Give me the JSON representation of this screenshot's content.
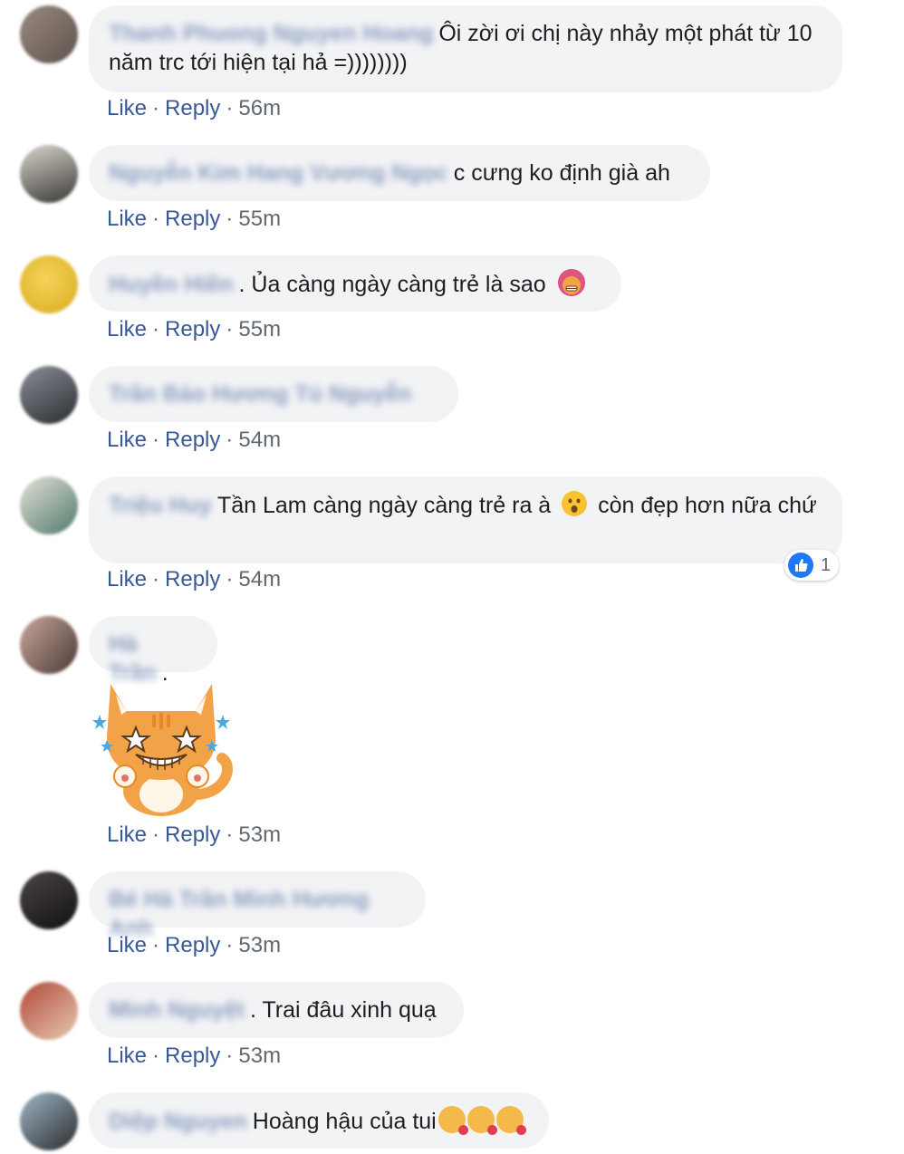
{
  "actions": {
    "like": "Like",
    "reply": "Reply",
    "sep": "·"
  },
  "comments": [
    {
      "name": "Thanh Phuong Nguyen Hoang",
      "text": "Ôi zời ơi chị này nhảy một phát từ 10 năm trc tới hiện tại hả =))))))))",
      "time": "56m"
    },
    {
      "name": "Nguyễn Kim Hang Vương Ngọc",
      "text": "c cưng ko định già ah",
      "time": "55m"
    },
    {
      "name": "Huyền Hiền",
      "text": ". Ủa càng ngày càng trẻ là sao",
      "emoji": "hot-face-emoji",
      "time": "55m"
    },
    {
      "name": "Trần Bảo Hương Tú Nguyễn",
      "text": "",
      "time": "54m"
    },
    {
      "name": "Triệu Huy",
      "text_before": "Tần Lam càng ngày càng trẻ ra à",
      "emoji": "astonished-face-emoji",
      "text_after": "còn đẹp hơn nữa chứ",
      "time": "54m",
      "reaction_count": "1"
    },
    {
      "name": "Hà Trần",
      "text": ".",
      "sticker": "cat-sticker",
      "time": "53m"
    },
    {
      "name": "Bé Hà Trần Minh Hương Anh",
      "text": "",
      "time": "53m"
    },
    {
      "name": "Minh Nguyệt",
      "text": ". Trai đâu xinh quạ",
      "time": "53m"
    },
    {
      "name": "Diệp Nguyen",
      "text": "Hoàng hậu của tui",
      "emoji": "smiling-cat-heart-emoji",
      "time": ""
    }
  ],
  "colors": {
    "link": "#385898",
    "bubble": "#f2f3f5",
    "meta": "#606770",
    "like_badge": "#2078f4"
  }
}
